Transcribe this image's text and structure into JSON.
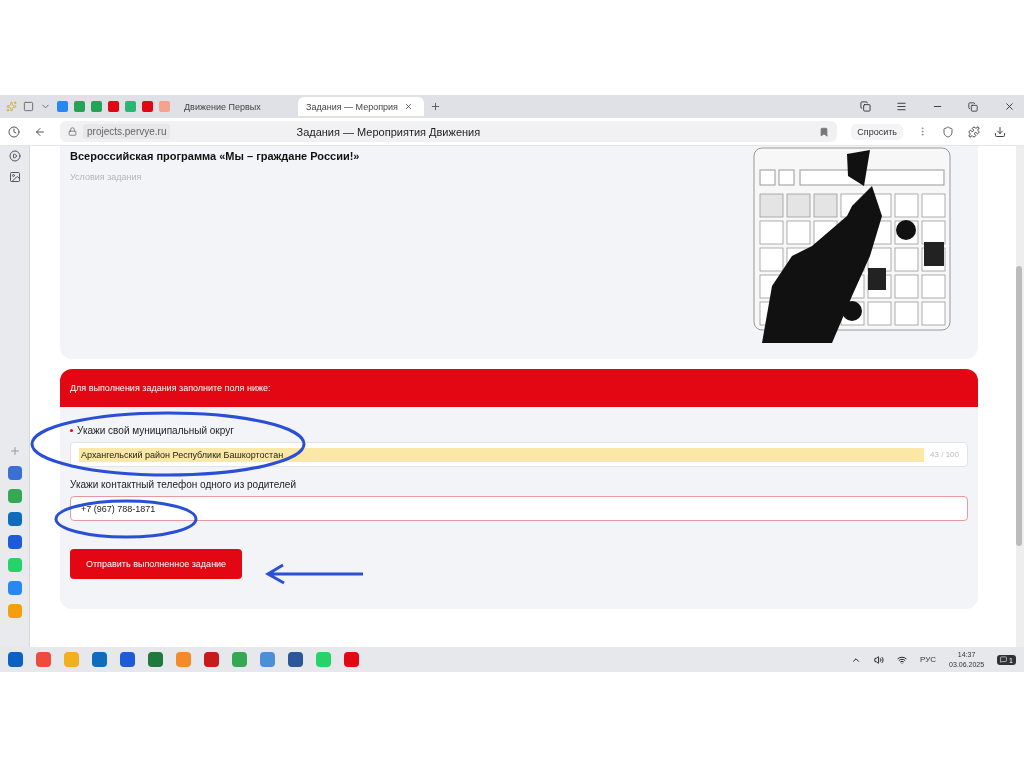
{
  "browser": {
    "tabs": [
      {
        "title": "Движение Первых",
        "selected": false
      },
      {
        "title": "Задания — Мероприя",
        "selected": true
      }
    ],
    "address": "projects.pervye.ru",
    "page_title": "Задания — Мероприятия Движения",
    "ask_button": "Спросить"
  },
  "task": {
    "title": "Всероссийская программа «Мы – граждане России!»",
    "conditions_label": "Условия задания"
  },
  "form": {
    "banner": "Для выполнения задания заполните поля ниже:",
    "fields": [
      {
        "label": "Укажи свой муниципальный округ",
        "required": true,
        "value": "Архангельский район Республики Башкортостан",
        "counter": "43 / 100",
        "autofilled": true,
        "error": false
      },
      {
        "label": "Укажи контактный телефон одного из родителей",
        "required": false,
        "value": "+7 (967) 788-1871",
        "autofilled": false,
        "error": true
      }
    ],
    "submit": "Отправить выполненное задание"
  },
  "taskbar": {
    "language": "РУС",
    "time": "14:37",
    "date": "03.06.2025",
    "notification_count": "1"
  }
}
